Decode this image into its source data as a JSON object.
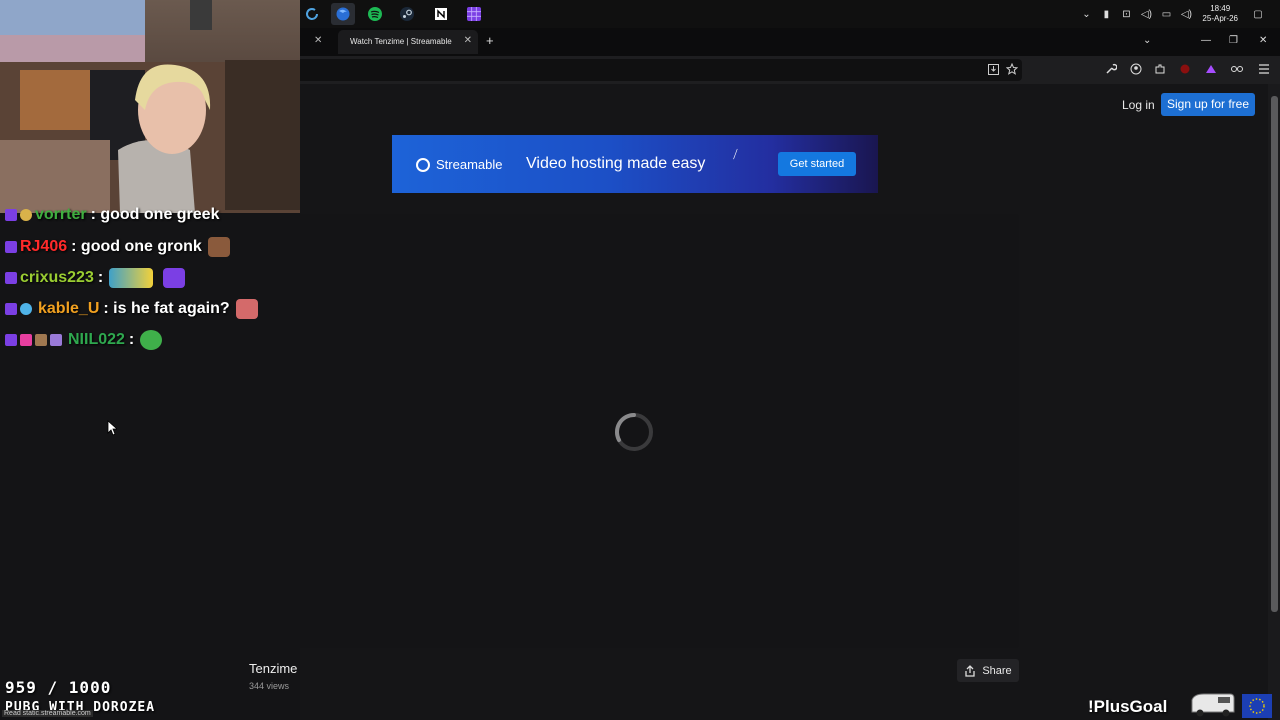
{
  "taskbar": {
    "apps": [
      "refresh-app-icon",
      "firefox-icon",
      "spotify-icon",
      "steam-icon",
      "notion-icon",
      "grid-app-icon"
    ],
    "clock_time": "18:49",
    "clock_date": "25-Apr-26"
  },
  "browser": {
    "tab_title": "Watch Tenzime | Streamable"
  },
  "site": {
    "login_label": "Log in",
    "signup_label": "Sign up for free",
    "banner": {
      "brand": "Streamable",
      "tagline": "Video hosting made easy",
      "cta": "Get started",
      "colors": {
        "start": "#1d63d8",
        "end": "#1a1650"
      }
    },
    "video": {
      "title": "Tenzime",
      "views": "344 views",
      "share_label": "Share"
    }
  },
  "chat": {
    "messages": [
      {
        "user": "vorrter",
        "color": "#3fae3f",
        "text": ": good one greek"
      },
      {
        "user": "RJ406",
        "color": "#ff2a2a",
        "text": ": good one gronk"
      },
      {
        "user": "crixus223",
        "color": "#9acd32",
        "text": ":"
      },
      {
        "user": "kable_U",
        "color": "#f0a020",
        "text": ": is he fat again?"
      },
      {
        "user": "NIIL022",
        "color": "#2fa84f",
        "text": ":"
      }
    ]
  },
  "overlay": {
    "goal_count": "959 / 1000",
    "goal_label": "PUBG WITH DOROZEA",
    "plus_goal": "!PlusGoal",
    "status_url": "Read static.streamable.com"
  },
  "colors": {
    "accent": "#1d6fd3",
    "page_bg": "#151517"
  }
}
